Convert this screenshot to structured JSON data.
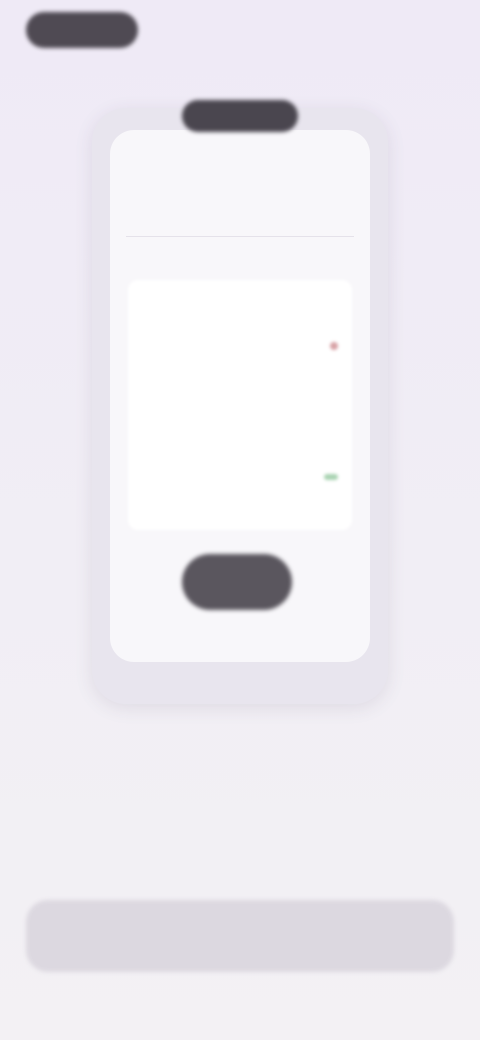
{
  "header": {
    "top_pill_label": ""
  },
  "mockup": {
    "pill_label": "",
    "title": "",
    "header_action": "",
    "rows": [
      {
        "label": "",
        "value": ""
      },
      {
        "label": "",
        "value": ""
      },
      {
        "label": "",
        "value": ""
      },
      {
        "label": "",
        "value": ""
      },
      {
        "label": "",
        "value": ""
      }
    ],
    "button_label": "",
    "caption": ""
  },
  "description": {
    "line1": "",
    "line2": ""
  },
  "cta": {
    "label": ""
  },
  "colors": {
    "background": "#efeaf6",
    "pill_dark": "#4f4a53",
    "accent_red": "#d8a2a6",
    "accent_green": "#a9d3b2",
    "cta_disabled": "#dcd8e0"
  }
}
